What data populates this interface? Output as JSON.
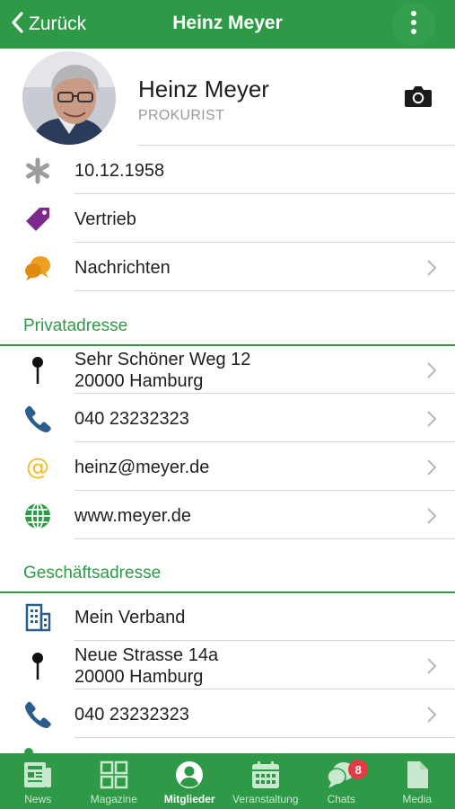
{
  "header": {
    "back_label": "Zurück",
    "title": "Heinz Meyer"
  },
  "profile": {
    "name": "Heinz Meyer",
    "role": "PROKURIST"
  },
  "info_rows": [
    {
      "icon": "asterisk-icon",
      "text": "10.12.1958"
    },
    {
      "icon": "tag-icon",
      "text": "Vertrieb"
    },
    {
      "icon": "chat-bubbles-icon",
      "text": "Nachrichten"
    }
  ],
  "private_address": {
    "heading": "Privatadresse",
    "street": "Sehr Schöner Weg 12",
    "city": "20000 Hamburg",
    "phone": "040 23232323",
    "email": "heinz@meyer.de",
    "website": "www.meyer.de"
  },
  "business_address": {
    "heading": "Geschäftsadresse",
    "organization": "Mein Verband",
    "street": "Neue Strasse 14a",
    "city": "20000 Hamburg",
    "phone": "040 23232323"
  },
  "tabbar": {
    "tabs": [
      {
        "label": "News",
        "icon": "newspaper-icon"
      },
      {
        "label": "Magazine",
        "icon": "grid-icon"
      },
      {
        "label": "Mitglieder",
        "icon": "user-circle-icon",
        "active": true
      },
      {
        "label": "Veranstaltung",
        "icon": "calendar-icon"
      },
      {
        "label": "Chats",
        "icon": "chat-icon",
        "badge": "8"
      },
      {
        "label": "Media",
        "icon": "document-icon"
      }
    ]
  },
  "colors": {
    "brand_green": "#2e9a47",
    "tag_purple": "#7e2a8c",
    "chat_orange": "#f0a020",
    "phone_blue": "#2b5d8a",
    "email_yellow": "#f0c020",
    "badge_red": "#e23b45"
  }
}
